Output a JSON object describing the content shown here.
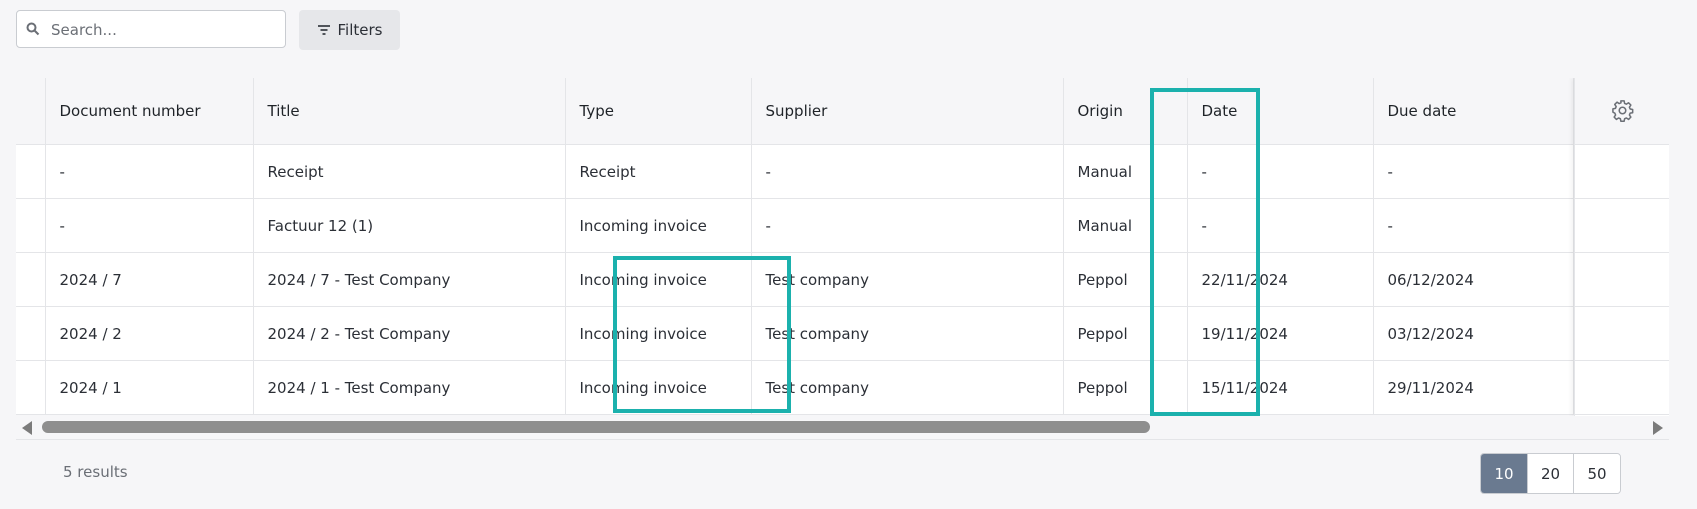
{
  "search": {
    "placeholder": "Search..."
  },
  "filters": {
    "label": "Filters"
  },
  "table": {
    "headers": [
      "Document number",
      "Title",
      "Type",
      "Supplier",
      "Origin",
      "Date",
      "Due date"
    ],
    "rows": [
      [
        "-",
        "Receipt",
        "Receipt",
        "-",
        "Manual",
        "-",
        "-"
      ],
      [
        "-",
        "Factuur 12 (1)",
        "Incoming invoice",
        "-",
        "Manual",
        "-",
        "-"
      ],
      [
        "2024 / 7",
        "2024 / 7 - Test Company",
        "Incoming invoice",
        "Test company",
        "Peppol",
        "22/11/2024",
        "06/12/2024"
      ],
      [
        "2024 / 2",
        "2024 / 2 - Test Company",
        "Incoming invoice",
        "Test company",
        "Peppol",
        "19/11/2024",
        "03/12/2024"
      ],
      [
        "2024 / 1",
        "2024 / 1 - Test Company",
        "Incoming invoice",
        "Test company",
        "Peppol",
        "15/11/2024",
        "29/11/2024"
      ]
    ]
  },
  "icons": {
    "search": "search-icon",
    "filters": "filter-icon",
    "settings": "gear-icon"
  },
  "highlight_color": "#1bb1ad",
  "footer": {
    "results": "5 results",
    "page_sizes": [
      "10",
      "20",
      "50"
    ],
    "active_page_size": "10"
  }
}
